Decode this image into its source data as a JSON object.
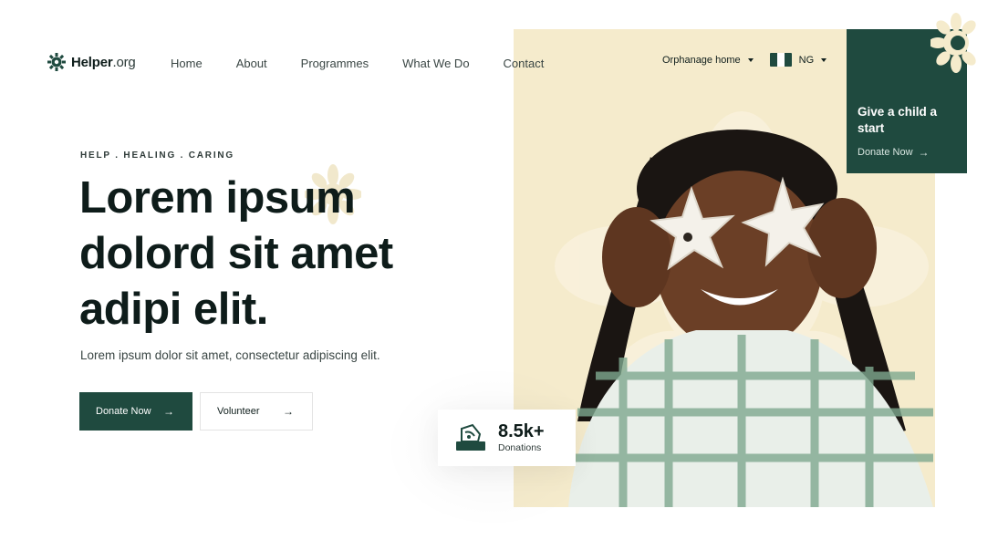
{
  "brand": {
    "name_bold": "Helper",
    "name_rest": ".org",
    "logo_icon": "sun-gear-icon"
  },
  "nav": {
    "items": [
      {
        "label": "Home"
      },
      {
        "label": "About"
      },
      {
        "label": "Programmes"
      },
      {
        "label": "What We Do"
      },
      {
        "label": "Contact"
      }
    ],
    "category_dropdown": "Orphanage home",
    "country_dropdown": "NG",
    "country_flag_colors": [
      "#1f4a3f",
      "#ffffff",
      "#1f4a3f"
    ]
  },
  "give_card": {
    "title": "Give a child a start",
    "link_label": "Donate Now",
    "link_icon": "arrow-right-icon"
  },
  "hero": {
    "eyebrow": "HELP . HEALING . CARING",
    "headline_lines": [
      "Lorem ipsum",
      "dolord sit amet",
      "adipi elit."
    ],
    "subtitle": "Lorem ipsum dolor sit amet, consectetur adipiscing elit.",
    "primary_button": "Donate Now",
    "secondary_button": "Volunteer",
    "photo": "girl-holding-snowflake-cookies"
  },
  "stats": {
    "value": "8.5k+",
    "label": "Donations",
    "icon": "donation-hand-icon"
  },
  "colors": {
    "accent": "#1f4a3f",
    "panel": "#f5ebcc",
    "text": "#0e1c1a"
  }
}
